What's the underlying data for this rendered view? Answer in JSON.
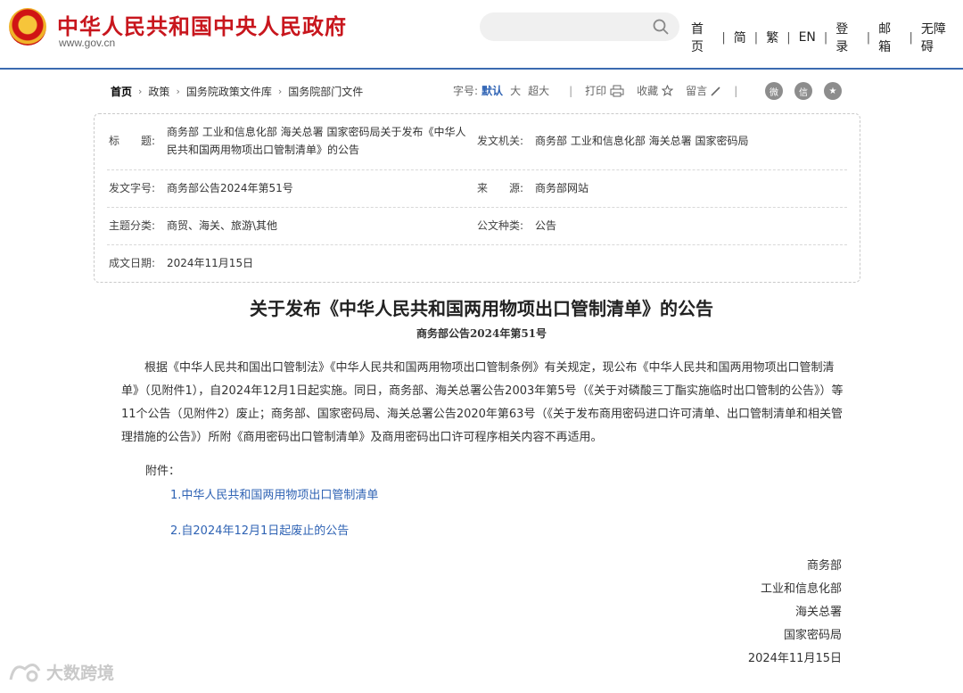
{
  "header": {
    "site_title": "中华人民共和国中央人民政府",
    "site_url": "www.gov.cn",
    "search_placeholder": "",
    "nav": [
      "首页",
      "简",
      "繁",
      "EN",
      "登录",
      "邮箱",
      "无障碍"
    ]
  },
  "breadcrumb": [
    "首页",
    "政策",
    "国务院政策文件库",
    "国务院部门文件"
  ],
  "tools": {
    "font_label": "字号:",
    "font_sizes": [
      "默认",
      "大",
      "超大"
    ],
    "print": "打印",
    "favorite": "收藏",
    "comment": "留言",
    "share_icons": [
      "weibo-icon",
      "wechat-icon",
      "qzone-icon"
    ]
  },
  "info": {
    "title_key": "标　　题:",
    "title_val_1": "商务部 工业和信息化部 海关总署 国家密码局关于发布《中华人",
    "title_val_2": "民共和国两用物项出口管制清单》的公告",
    "issuer_key": "发文机关:",
    "issuer_val": "商务部 工业和信息化部 海关总署 国家密码局",
    "docno_key": "发文字号:",
    "docno_val": "商务部公告2024年第51号",
    "source_key": "来　　源:",
    "source_val": "商务部网站",
    "topic_key": "主题分类:",
    "topic_val": "商贸、海关、旅游\\其他",
    "type_key": "公文种类:",
    "type_val": "公告",
    "date_key": "成文日期:",
    "date_val": "2024年11月15日"
  },
  "article": {
    "title": "关于发布《中华人民共和国两用物项出口管制清单》的公告",
    "doc_no": "商务部公告2024年第51号",
    "body": "根据《中华人民共和国出口管制法》《中华人民共和国两用物项出口管制条例》有关规定，现公布《中华人民共和国两用物项出口管制清单》（见附件1），自2024年12月1日起实施。同日，商务部、海关总署公告2003年第5号（《关于对磷酸三丁酯实施临时出口管制的公告》）等11个公告（见附件2）废止；商务部、国家密码局、海关总署公告2020年第63号（《关于发布商用密码进口许可清单、出口管制清单和相关管理措施的公告》）所附《商用密码出口管制清单》及商用密码出口许可程序相关内容不再适用。",
    "attachments_label": "附件：",
    "attachments": [
      "1.中华人民共和国两用物项出口管制清单",
      "2.自2024年12月1日起废止的公告"
    ],
    "signatories": [
      "商务部",
      "工业和信息化部",
      "海关总署",
      "国家密码局",
      "2024年11月15日"
    ]
  },
  "watermark": "大数跨境",
  "colors": {
    "brand_red": "#c8161d",
    "link_blue": "#2f63b4",
    "header_line": "#3b6bb0"
  }
}
